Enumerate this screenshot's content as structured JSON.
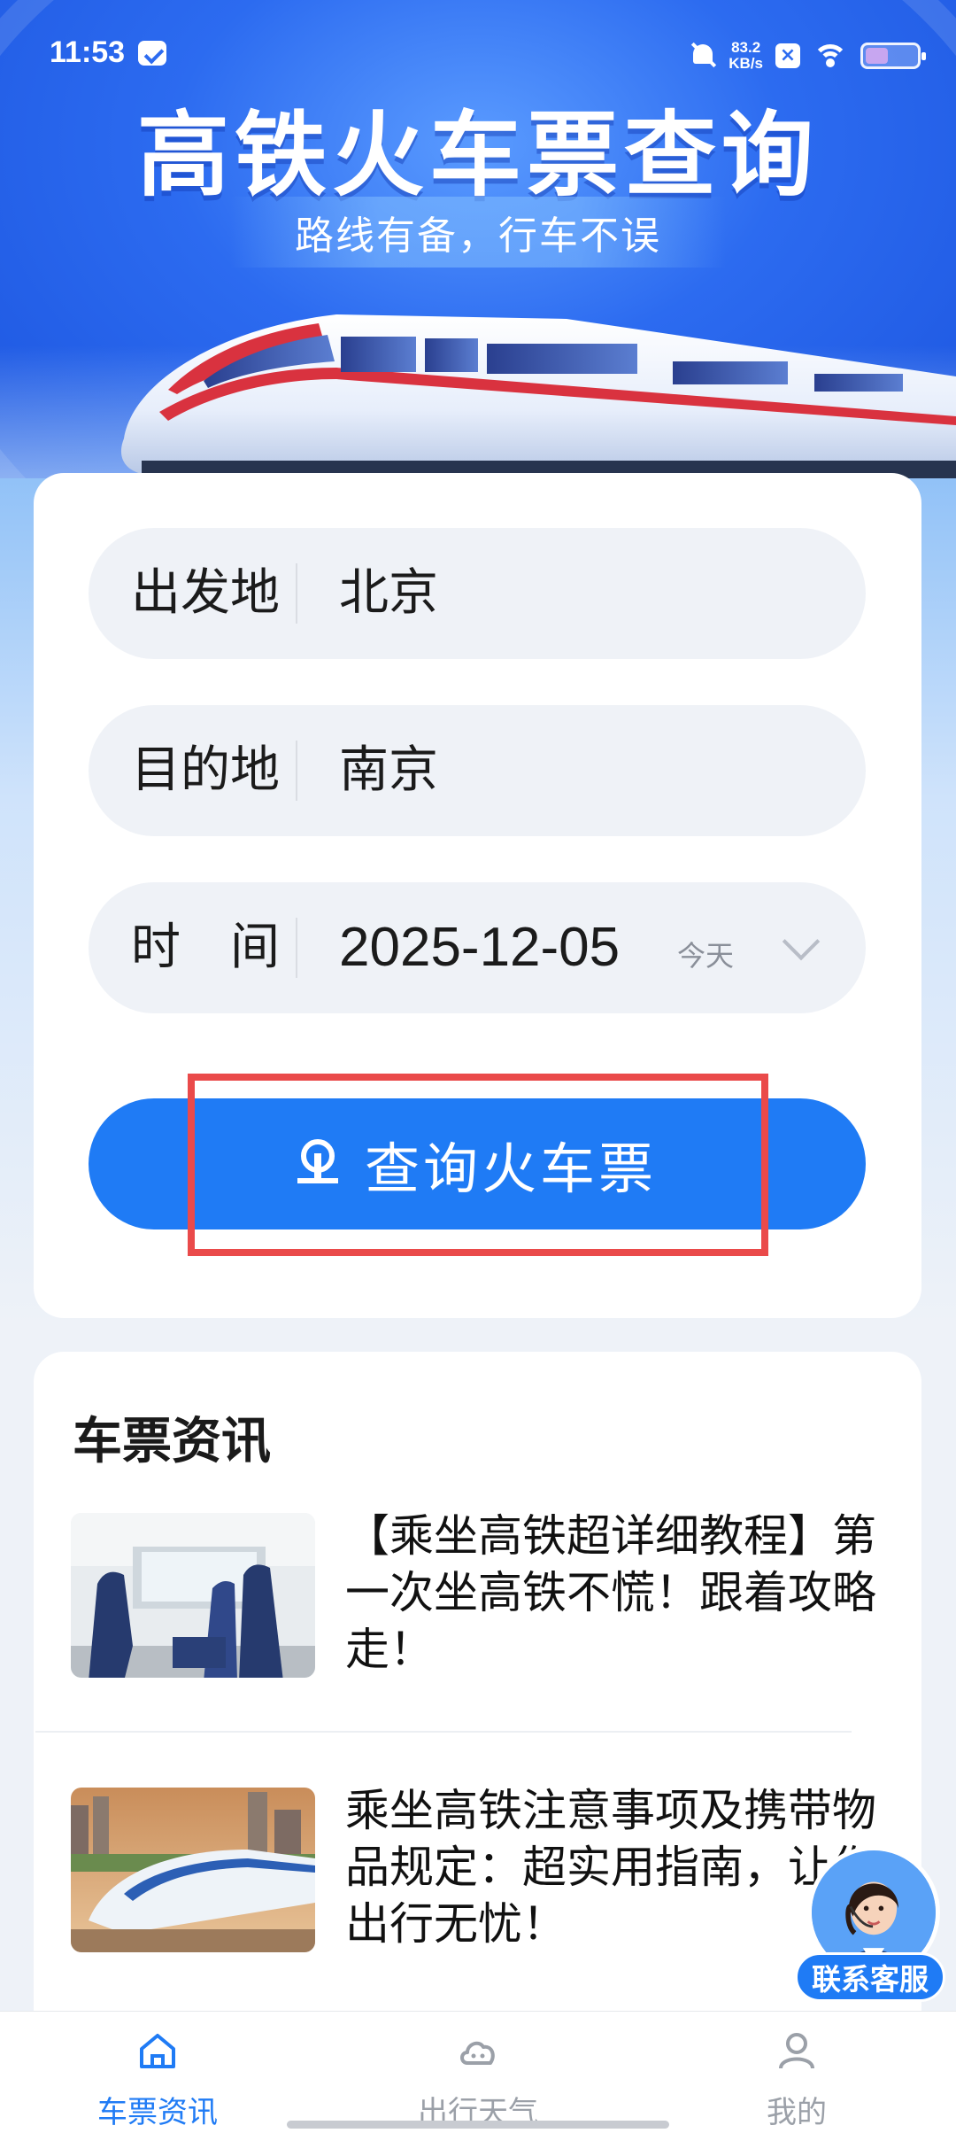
{
  "status_bar": {
    "time": "11:53",
    "net_speed_value": "83.2",
    "net_speed_unit": "KB/s",
    "battery_level": 0.45
  },
  "hero": {
    "title": "高铁火车票查询",
    "subtitle": "路线有备，行车不误"
  },
  "form": {
    "from_label": "出发地",
    "from_value": "北京",
    "to_label": "目的地",
    "to_value": "南京",
    "date_label": "时　间",
    "date_value": "2025-12-05",
    "date_tag": "今天",
    "search_button": "查询火车票"
  },
  "news": {
    "section_title": "车票资讯",
    "items": [
      {
        "title": "【乘坐高铁超详细教程】第一次坐高铁不慌！跟着攻略走！"
      },
      {
        "title": "乘坐高铁注意事项及携带物品规定：超实用指南，让你出行无忧！"
      }
    ]
  },
  "customer_service": {
    "label": "联系客服"
  },
  "tab_bar": {
    "tabs": [
      {
        "label": "车票资讯",
        "icon": "home-icon",
        "active": true
      },
      {
        "label": "出行天气",
        "icon": "cloud-icon",
        "active": false
      },
      {
        "label": "我的",
        "icon": "user-icon",
        "active": false
      }
    ]
  },
  "colors": {
    "accent": "#1f7bf5",
    "highlight": "#ea4a4a",
    "inactive_tab": "#9ba0a8"
  }
}
